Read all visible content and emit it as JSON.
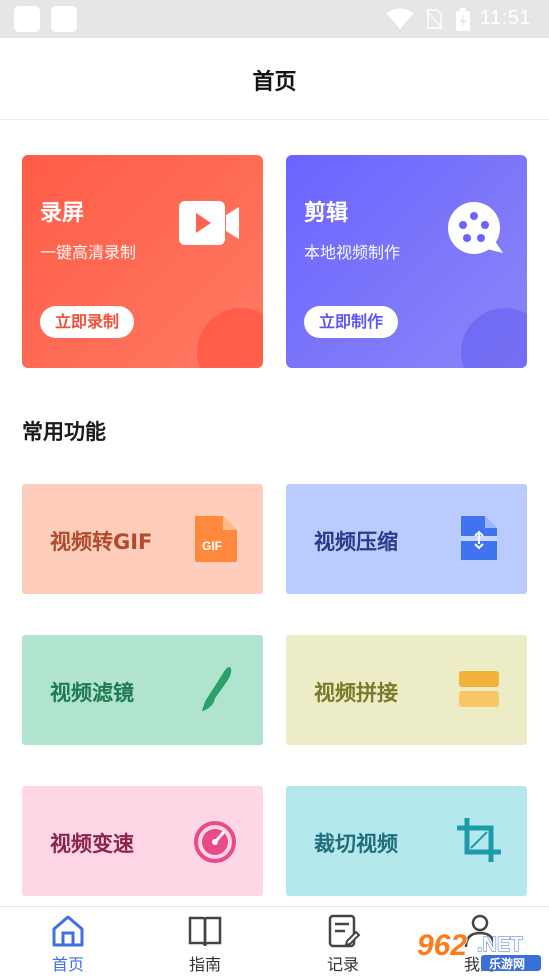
{
  "status_bar": {
    "time": "11:51",
    "icons": [
      "app-square-icon",
      "app-square-icon",
      "wifi-icon",
      "no-sim-icon",
      "battery-charging-icon"
    ]
  },
  "header": {
    "title": "首页"
  },
  "hero_cards": [
    {
      "title": "录屏",
      "subtitle": "一键高清录制",
      "button": "立即录制",
      "icon": "video-camera-icon",
      "color": "#ff6250"
    },
    {
      "title": "剪辑",
      "subtitle": "本地视频制作",
      "button": "立即制作",
      "icon": "film-reel-icon",
      "color": "#7670fb"
    }
  ],
  "section": {
    "title": "常用功能"
  },
  "features": [
    {
      "label": "视频转GIF",
      "icon": "gif-file-icon",
      "bg": "#ffcdbb",
      "fg": "#b04c2c"
    },
    {
      "label": "视频压缩",
      "icon": "compress-file-icon",
      "bg": "#b9cbff",
      "fg": "#2b3a8a"
    },
    {
      "label": "视频滤镜",
      "icon": "brush-icon",
      "bg": "#b1e4cf",
      "fg": "#1f7a52"
    },
    {
      "label": "视频拼接",
      "icon": "merge-icon",
      "bg": "#ececc6",
      "fg": "#7a7a2a"
    },
    {
      "label": "视频变速",
      "icon": "speedometer-icon",
      "bg": "#ffd6e6",
      "fg": "#8a2350"
    },
    {
      "label": "裁切视频",
      "icon": "crop-icon",
      "bg": "#b4e8ec",
      "fg": "#1f6f7a"
    }
  ],
  "bottom_nav": [
    {
      "label": "首页",
      "icon": "home-icon",
      "active": true
    },
    {
      "label": "指南",
      "icon": "book-icon",
      "active": false
    },
    {
      "label": "记录",
      "icon": "note-icon",
      "active": false
    },
    {
      "label": "我的",
      "icon": "user-icon",
      "active": false
    }
  ],
  "watermark": {
    "text": "962.NET",
    "subtext": "乐游网"
  }
}
